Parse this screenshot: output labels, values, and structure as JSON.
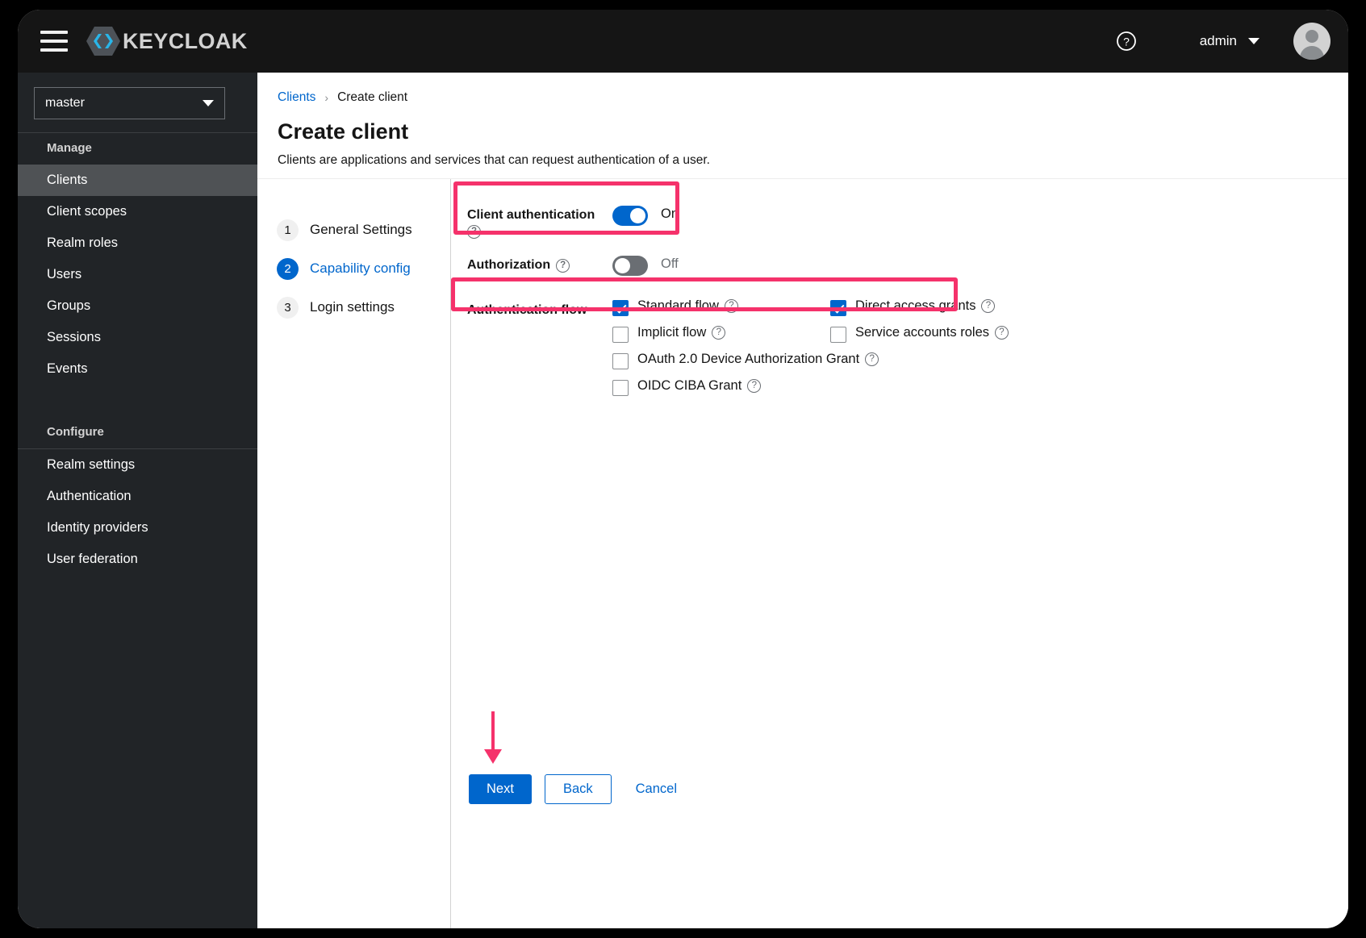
{
  "masthead": {
    "brand_name": "KEYCLOAK",
    "menu_icon": "hamburger-menu-icon",
    "help_icon": "help-circle-icon",
    "user_name": "admin",
    "avatar_icon": "user-avatar-icon"
  },
  "sidebar": {
    "realm": {
      "selected": "master"
    },
    "groups": [
      {
        "title": "Manage",
        "items": [
          {
            "label": "Clients",
            "active": true
          },
          {
            "label": "Client scopes",
            "active": false
          },
          {
            "label": "Realm roles",
            "active": false
          },
          {
            "label": "Users",
            "active": false
          },
          {
            "label": "Groups",
            "active": false
          },
          {
            "label": "Sessions",
            "active": false
          },
          {
            "label": "Events",
            "active": false
          }
        ]
      },
      {
        "title": "Configure",
        "items": [
          {
            "label": "Realm settings",
            "active": false
          },
          {
            "label": "Authentication",
            "active": false
          },
          {
            "label": "Identity providers",
            "active": false
          },
          {
            "label": "User federation",
            "active": false
          }
        ]
      }
    ]
  },
  "breadcrumb": {
    "parent": "Clients",
    "separator": "›",
    "current": "Create client"
  },
  "page": {
    "title": "Create client",
    "subtitle": "Clients are applications and services that can request authentication of a user."
  },
  "wizard": {
    "steps": [
      {
        "num": "1",
        "label": "General Settings",
        "current": false
      },
      {
        "num": "2",
        "label": "Capability config",
        "current": true
      },
      {
        "num": "3",
        "label": "Login settings",
        "current": false
      }
    ]
  },
  "form": {
    "client_authentication": {
      "label": "Client authentication",
      "help_icon": "help-circle-icon",
      "toggle_state": "on",
      "toggle_text": "On"
    },
    "authorization": {
      "label": "Authorization",
      "help_icon": "help-circle-icon",
      "toggle_state": "off",
      "toggle_text": "Off"
    },
    "authentication_flow": {
      "label": "Authentication flow",
      "options": [
        {
          "label": "Standard flow",
          "checked": true,
          "help_icon": "help-circle-icon"
        },
        {
          "label": "Direct access grants",
          "checked": true,
          "help_icon": "help-circle-icon"
        },
        {
          "label": "Implicit flow",
          "checked": false,
          "help_icon": "help-circle-icon"
        },
        {
          "label": "Service accounts roles",
          "checked": false,
          "help_icon": "help-circle-icon"
        },
        {
          "label": "OAuth 2.0 Device Authorization Grant",
          "checked": false,
          "help_icon": "help-circle-icon"
        },
        {
          "label": "OIDC CIBA Grant",
          "checked": false,
          "help_icon": "help-circle-icon"
        }
      ]
    }
  },
  "footer": {
    "next_label": "Next",
    "back_label": "Back",
    "cancel_label": "Cancel"
  },
  "annotations": {
    "color": "#f5326b",
    "arrow_icon": "down-arrow-annotation"
  }
}
